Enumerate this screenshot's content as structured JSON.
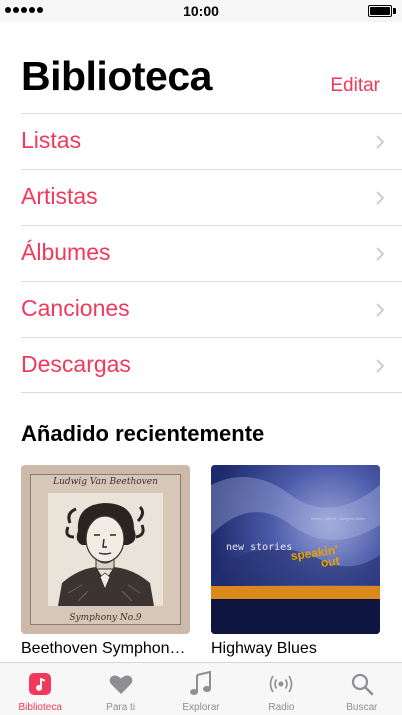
{
  "status_bar": {
    "time": "10:00"
  },
  "header": {
    "title": "Biblioteca",
    "edit_label": "Editar"
  },
  "library_items": [
    {
      "label": "Listas"
    },
    {
      "label": "Artistas"
    },
    {
      "label": "Álbumes"
    },
    {
      "label": "Canciones"
    },
    {
      "label": "Descargas"
    }
  ],
  "recently_added": {
    "title": "Añadido recientemente",
    "albums": [
      {
        "title": "Beethoven Symphon…",
        "cover_text_top": "Ludwig Van Beethoven",
        "cover_text_bottom": "Symphony No.9"
      },
      {
        "title": "Highway Blues",
        "cover_text_small": "Kenny Garrett · Mulgrew Miller",
        "cover_text_main": "new stories",
        "cover_text_accent_1": "speakin'",
        "cover_text_accent_2": "out"
      }
    ]
  },
  "tab_bar": {
    "tabs": [
      {
        "label": "Biblioteca",
        "icon": "library-icon",
        "active": true
      },
      {
        "label": "Para ti",
        "icon": "heart-icon",
        "active": false
      },
      {
        "label": "Explorar",
        "icon": "music-note-icon",
        "active": false
      },
      {
        "label": "Radio",
        "icon": "radio-icon",
        "active": false
      },
      {
        "label": "Buscar",
        "icon": "search-icon",
        "active": false
      }
    ]
  },
  "colors": {
    "accent": "#f2395b",
    "inactive": "#8e8e93",
    "separator": "#dcdcdc"
  }
}
